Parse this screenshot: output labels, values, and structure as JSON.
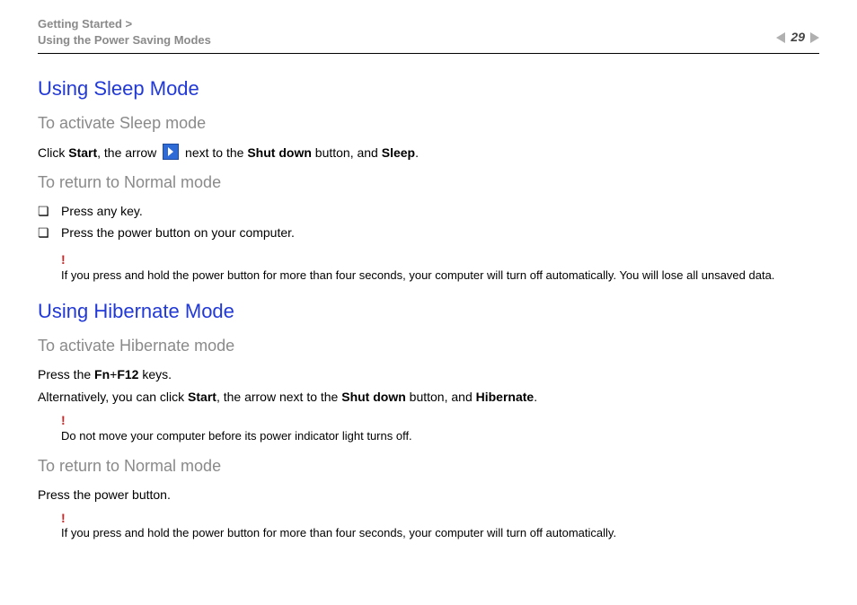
{
  "header": {
    "breadcrumb_top": "Getting Started >",
    "breadcrumb_sub": "Using the Power Saving Modes",
    "page_number": "29"
  },
  "sleep": {
    "title": "Using Sleep Mode",
    "activate_heading": "To activate Sleep mode",
    "activate_pre": "Click ",
    "activate_b1": "Start",
    "activate_mid1": ", the arrow ",
    "activate_mid2": " next to the ",
    "activate_b2": "Shut down",
    "activate_mid3": " button, and ",
    "activate_b3": "Sleep",
    "activate_end": ".",
    "return_heading": "To return to Normal mode",
    "bullets": {
      "0": "Press any key.",
      "1": "Press the power button on your computer."
    },
    "warn": "If you press and hold the power button for more than four seconds, your computer will turn off automatically. You will lose all unsaved data."
  },
  "hibernate": {
    "title": "Using Hibernate Mode",
    "activate_heading": "To activate Hibernate mode",
    "line1_pre": "Press the ",
    "line1_b1": "Fn",
    "line1_plus": "+",
    "line1_b2": "F12",
    "line1_end": " keys.",
    "line2_pre": "Alternatively, you can click ",
    "line2_b1": "Start",
    "line2_mid1": ", the arrow next to the ",
    "line2_b2": "Shut down",
    "line2_mid2": " button, and ",
    "line2_b3": "Hibernate",
    "line2_end": ".",
    "warn1": "Do not move your computer before its power indicator light turns off.",
    "return_heading": "To return to Normal mode",
    "return_text": "Press the power button.",
    "warn2": "If you press and hold the power button for more than four seconds, your computer will turn off automatically."
  },
  "glyphs": {
    "bang": "!"
  }
}
